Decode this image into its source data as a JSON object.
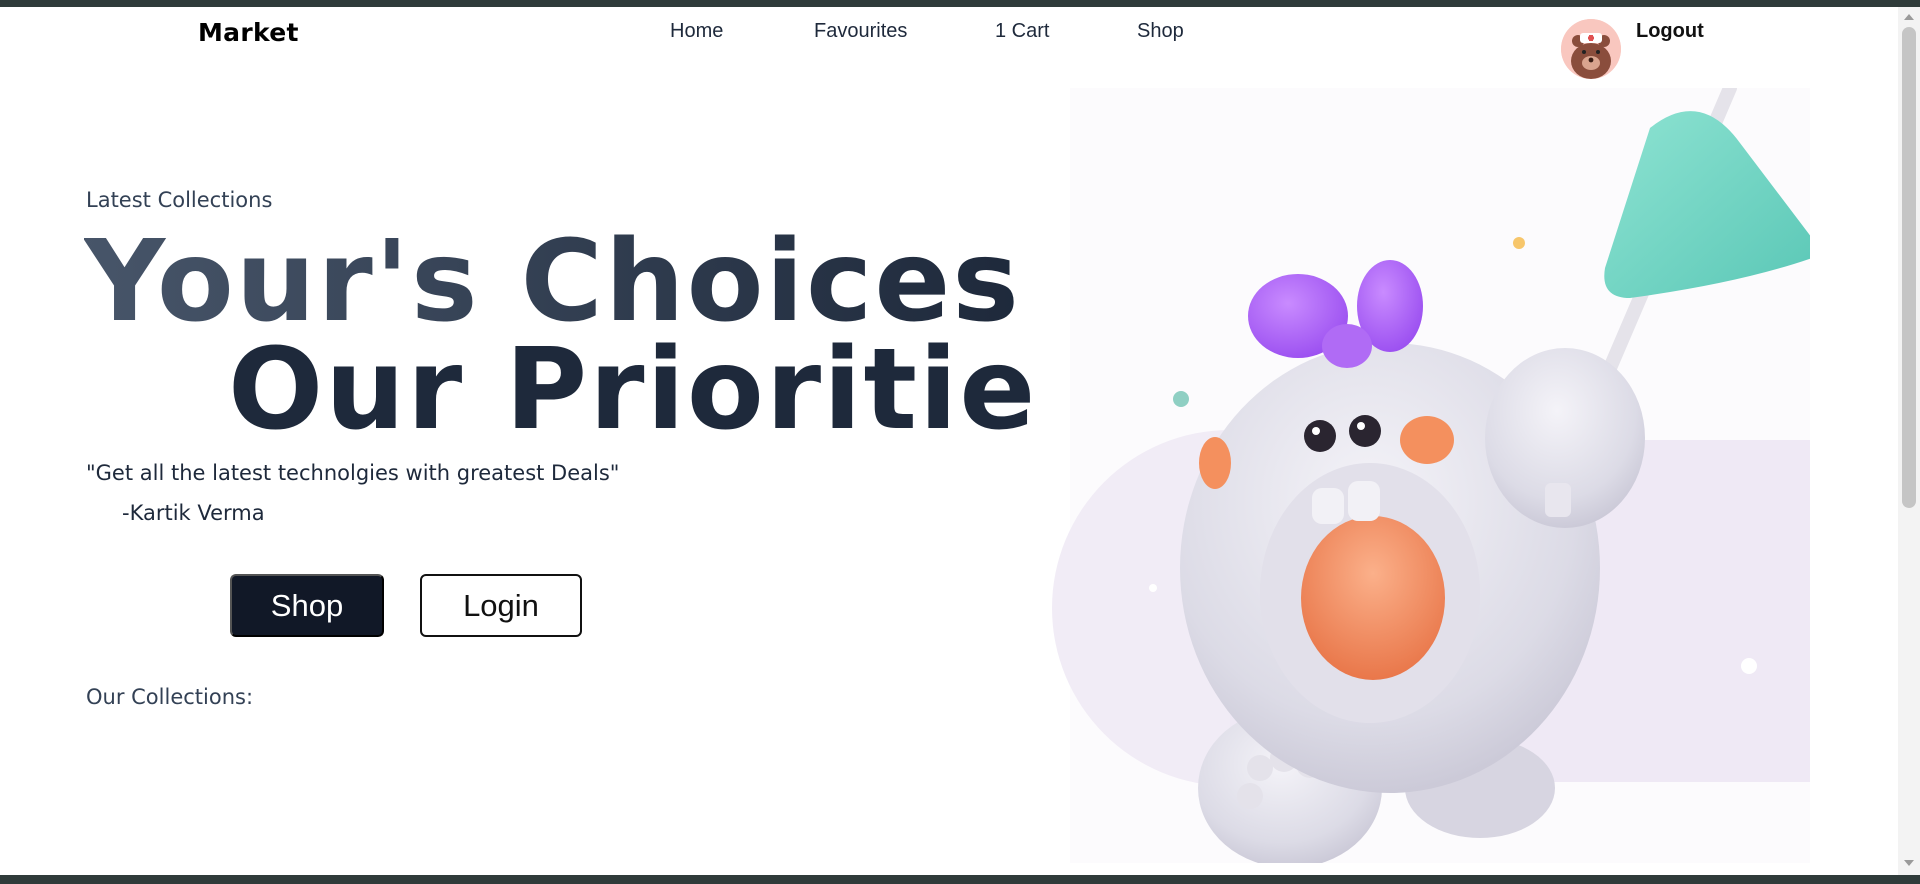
{
  "header": {
    "brand": "Market",
    "nav": [
      {
        "label": "Home"
      },
      {
        "label": "Favourites"
      },
      {
        "label": "1 Cart"
      },
      {
        "label": "Shop"
      }
    ],
    "logout_label": "Logout"
  },
  "hero": {
    "eyebrow": "Latest Collections",
    "headline_line1": "Your's Choices",
    "headline_line2": "Our Priorities",
    "quote": "\"Get all the latest technolgies with greatest Deals\"",
    "author": "-Kartik Verma",
    "shop_button": "Shop",
    "login_button": "Login",
    "collections_label": "Our Collections:"
  },
  "colors": {
    "primary_dark": "#111827",
    "text": "#1e293b",
    "lavender_bg": "#efe9f5",
    "bow": "#a855f7",
    "flag": "#6dd3c2",
    "mouth": "#f08a5d"
  },
  "icons": {
    "avatar": "bear-avatar-icon",
    "illustration": "monster-mascot-illustration"
  }
}
